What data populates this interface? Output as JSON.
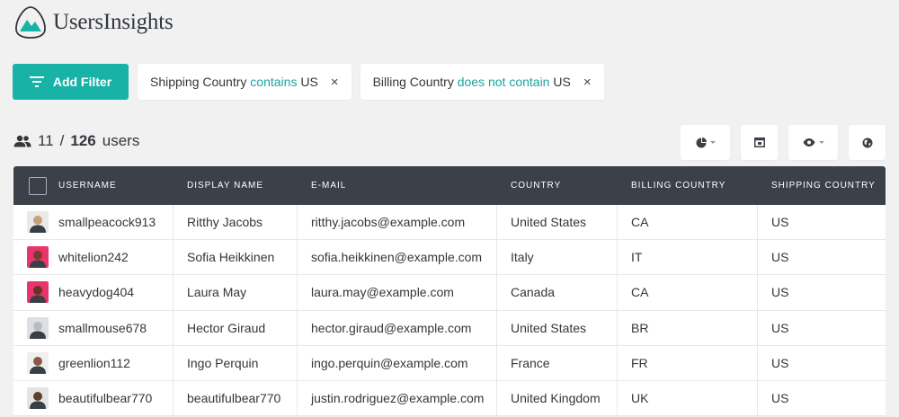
{
  "app": {
    "brand": "UsersInsights",
    "accent": "#18b2a6",
    "header_bg": "#3b4149"
  },
  "filters": {
    "add_label": "Add Filter",
    "chips": [
      {
        "field": "Shipping Country",
        "op": "contains",
        "value": "US"
      },
      {
        "field": "Billing Country",
        "op": "does not contain",
        "value": "US"
      }
    ],
    "close_glyph": "×"
  },
  "summary": {
    "shown": "11",
    "separator": "/",
    "total": "126",
    "unit": "users"
  },
  "toolbar": {
    "icons": [
      "pie-chart-icon",
      "layout-icon",
      "eye-icon",
      "globe-icon"
    ]
  },
  "table": {
    "columns": [
      "Username",
      "Display Name",
      "E-mail",
      "Country",
      "Billing Country",
      "Shipping Country"
    ],
    "rows": [
      {
        "avatar": "#c9a07a",
        "bg": "#e9e9e9",
        "username": "smallpeacock913",
        "display": "Ritthy Jacobs",
        "email": "ritthy.jacobs@example.com",
        "country": "United States",
        "billing": "CA",
        "shipping": "US"
      },
      {
        "avatar": "#7a3b2e",
        "bg": "#e8356b",
        "username": "whitelion242",
        "display": "Sofia Heikkinen",
        "email": "sofia.heikkinen@example.com",
        "country": "Italy",
        "billing": "IT",
        "shipping": "US"
      },
      {
        "avatar": "#6b3324",
        "bg": "#e8356b",
        "username": "heavydog404",
        "display": "Laura May",
        "email": "laura.may@example.com",
        "country": "Canada",
        "billing": "CA",
        "shipping": "US"
      },
      {
        "avatar": "#b9bcc0",
        "bg": "#dcdfe3",
        "username": "smallmouse678",
        "display": "Hector Giraud",
        "email": "hector.giraud@example.com",
        "country": "United States",
        "billing": "BR",
        "shipping": "US"
      },
      {
        "avatar": "#8a5a44",
        "bg": "#efefef",
        "username": "greenlion112",
        "display": "Ingo Perquin",
        "email": "ingo.perquin@example.com",
        "country": "France",
        "billing": "FR",
        "shipping": "US"
      },
      {
        "avatar": "#5b4030",
        "bg": "#e4e4e4",
        "username": "beautifulbear770",
        "display": "beautifulbear770",
        "email": "justin.rodriguez@example.com",
        "country": "United Kingdom",
        "billing": "UK",
        "shipping": "US"
      }
    ]
  }
}
